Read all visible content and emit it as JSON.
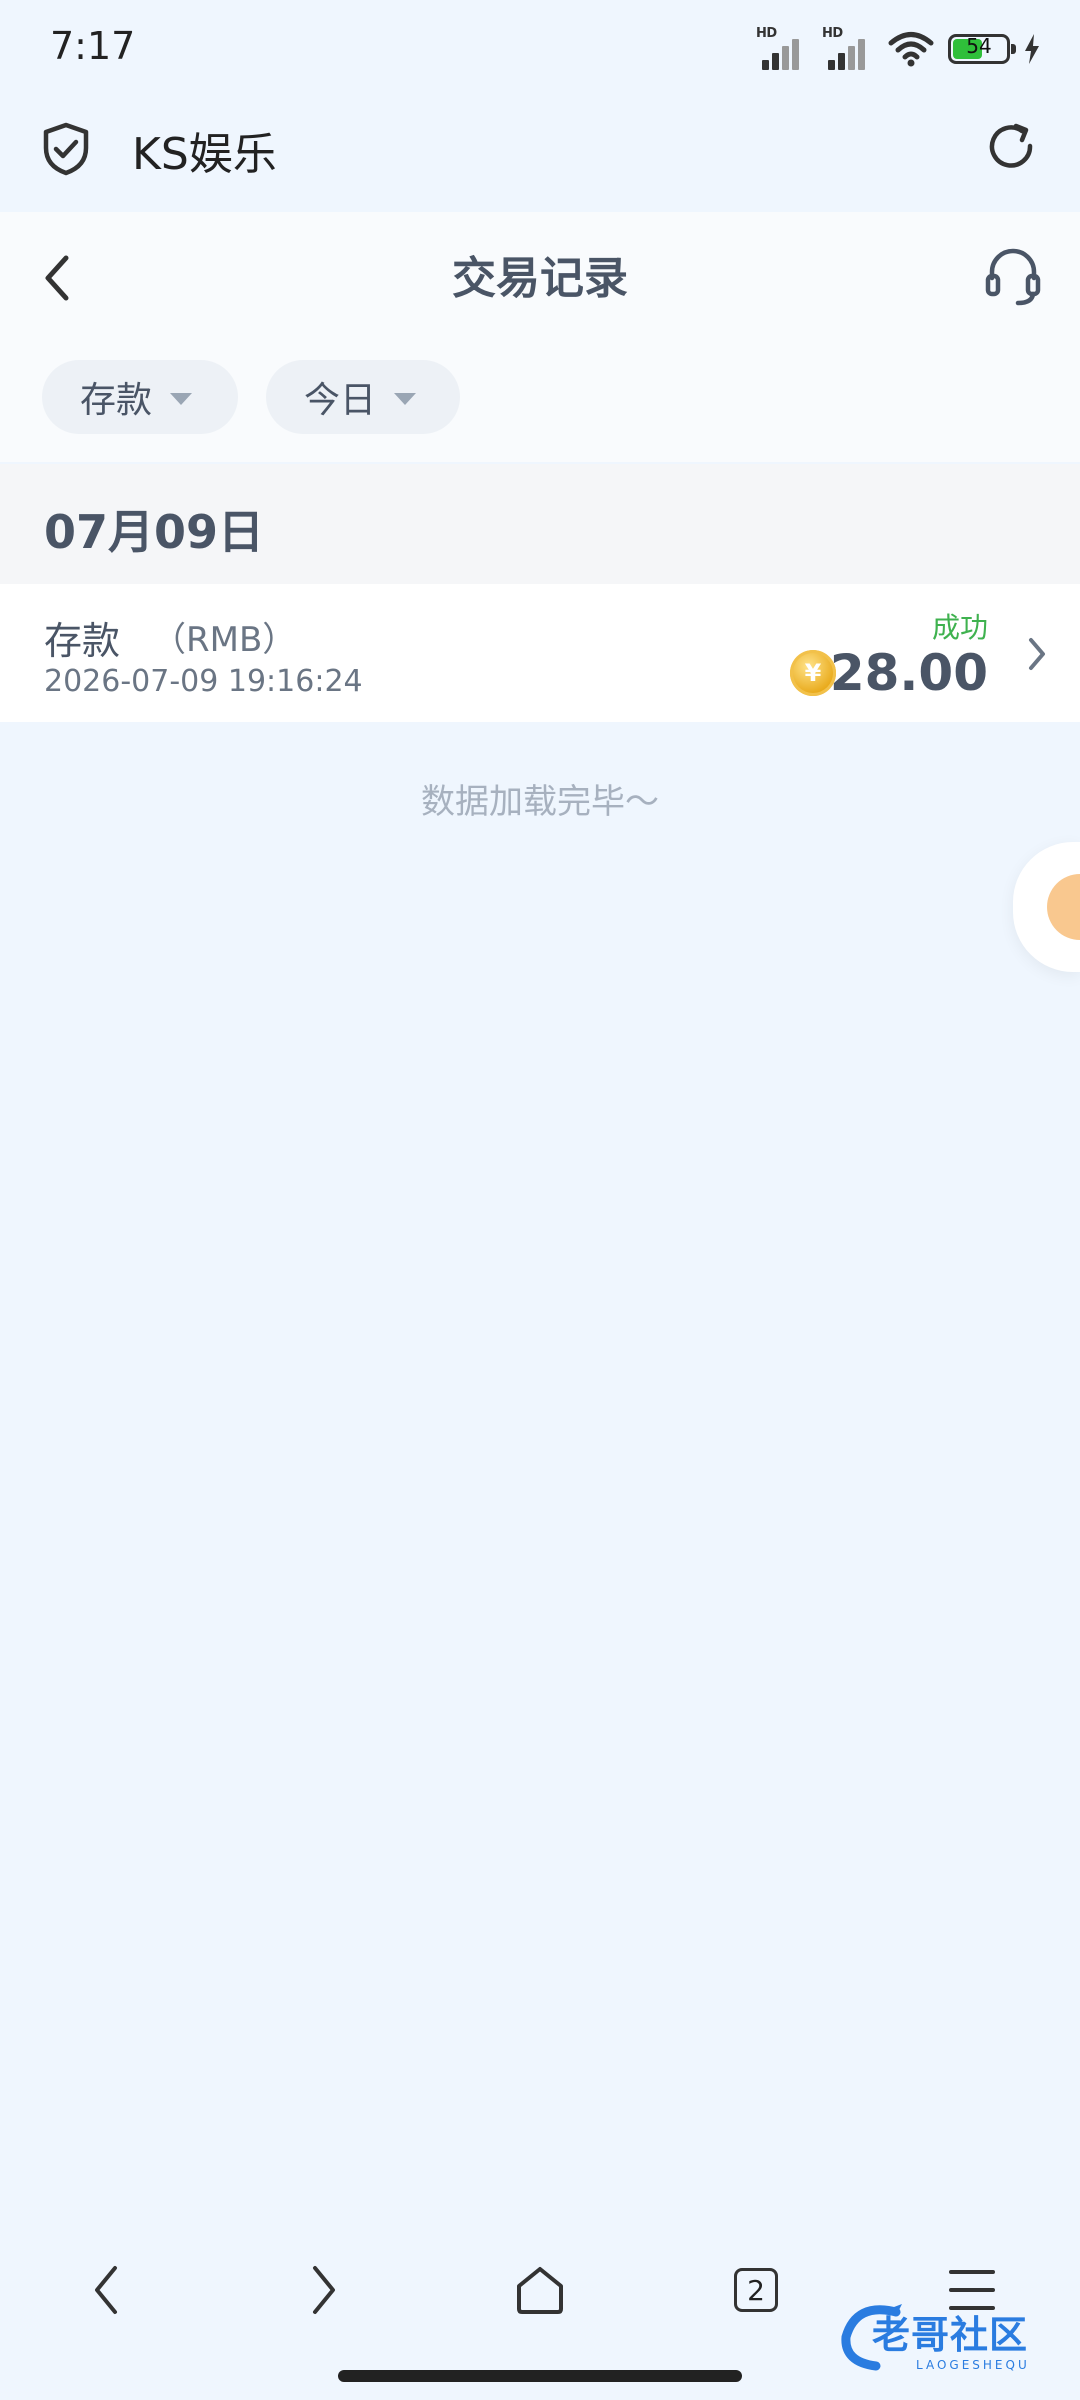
{
  "status_bar": {
    "time": "7:17",
    "signal_label_1": "HD",
    "signal_label_2": "HD",
    "battery_level": "54"
  },
  "browser": {
    "site_title": "KS娱乐",
    "shield_icon": "shield-check-icon",
    "refresh_icon": "refresh-icon"
  },
  "header": {
    "title": "交易记录",
    "back_icon": "chevron-left-icon",
    "support_icon": "headset-icon"
  },
  "filters": {
    "type_label": "存款",
    "period_label": "今日"
  },
  "records": {
    "date": "07月09日",
    "items": [
      {
        "type": "存款",
        "currency": "（RMB）",
        "time": "2026-07-09 19:16:24",
        "status": "成功",
        "amount": "28.00",
        "coin_symbol": "¥"
      }
    ],
    "end_message": "数据加载完毕～"
  },
  "bottom_nav": {
    "tab_count": "2"
  },
  "watermark": {
    "text": "老哥社区",
    "sub": "LAOGESHEQU"
  },
  "colors": {
    "page_bg": "#eff6fe",
    "success": "#3fb24f",
    "text": "#4a5566",
    "coin": "#e8a818",
    "watermark": "#2a7ce0"
  }
}
